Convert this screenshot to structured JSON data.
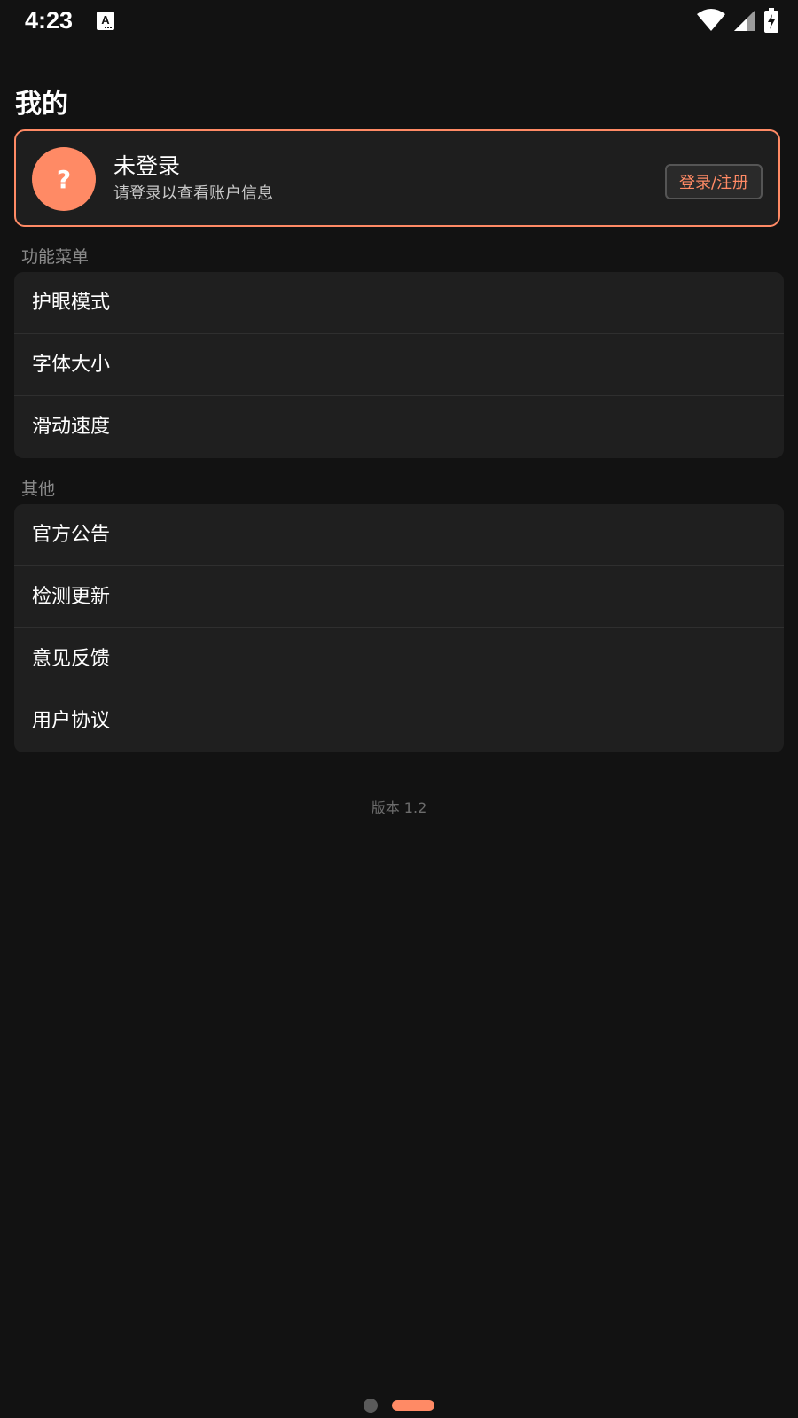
{
  "status_bar": {
    "time": "4:23",
    "notification_icon": "a-accessibility-icon",
    "right_icons": [
      "wifi-icon",
      "cell-signal-icon",
      "battery-charging-icon"
    ]
  },
  "header": {
    "title": "我的"
  },
  "profile": {
    "avatar_text": "?",
    "name": "未登录",
    "subtitle": "请登录以查看账户信息",
    "login_button": "登录/注册"
  },
  "sections": [
    {
      "title": "功能菜单",
      "items": [
        "护眼模式",
        "字体大小",
        "滑动速度"
      ]
    },
    {
      "title": "其他",
      "items": [
        "官方公告",
        "检测更新",
        "意见反馈",
        "用户协议"
      ]
    }
  ],
  "footer": {
    "version": "版本 1.2"
  },
  "pager": {
    "pages": 2,
    "active_index": 1
  },
  "colors": {
    "accent": "#ff8a65",
    "background": "#121212",
    "card": "#1f1f1f"
  }
}
